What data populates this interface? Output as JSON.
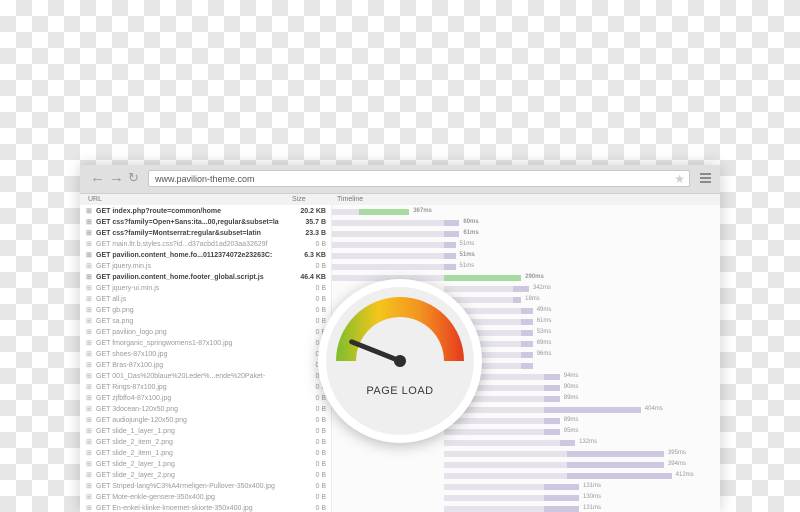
{
  "browser": {
    "back_icon": "arrow-left-icon",
    "forward_icon": "arrow-right-icon",
    "reload_icon": "reload-icon",
    "url": "www.pavilion-theme.com",
    "star_icon": "star-icon",
    "menu_icon": "hamburger-menu-icon"
  },
  "network": {
    "columns": {
      "url": "URL",
      "size": "Size",
      "timeline": "Timeline"
    },
    "rows": [
      {
        "url": "GET index.php?route=common/home",
        "size": "20.2 KB",
        "ms": "367ms",
        "bold": true,
        "wait": 0.0,
        "start": 0.07,
        "dur": 0.13,
        "color": "green"
      },
      {
        "url": "GET css?family=Open+Sans:ita...00,regular&subset=la",
        "size": "35.7 B",
        "ms": "60ms",
        "bold": true,
        "wait": 0.0,
        "start": 0.29,
        "dur": 0.04,
        "color": "purple"
      },
      {
        "url": "GET css?family=Montserrat:regular&subset=latin",
        "size": "23.3 B",
        "ms": "61ms",
        "bold": true,
        "wait": 0.0,
        "start": 0.29,
        "dur": 0.04,
        "color": "purple"
      },
      {
        "url": "GET main.ltr.b.styles.css?id...d37acbd1ad203aa32629f",
        "size": "0 B",
        "ms": "51ms",
        "bold": false,
        "wait": 0.0,
        "start": 0.29,
        "dur": 0.03,
        "color": "purple"
      },
      {
        "url": "GET pavilion.content_home.fo...0112374072e23263C:",
        "size": "6.3 KB",
        "ms": "51ms",
        "bold": true,
        "wait": 0.0,
        "start": 0.29,
        "dur": 0.03,
        "color": "purple"
      },
      {
        "url": "GET jquery.min.js",
        "size": "0 B",
        "ms": "51ms",
        "bold": false,
        "wait": 0.0,
        "start": 0.29,
        "dur": 0.03,
        "color": "purple"
      },
      {
        "url": "GET pavilion.content_home.footer_global.script.js",
        "size": "46.4 KB",
        "ms": "290ms",
        "bold": true,
        "wait": 0.0,
        "start": 0.29,
        "dur": 0.2,
        "color": "green"
      },
      {
        "url": "GET jquery-ui.min.js",
        "size": "0 B",
        "ms": "342ms",
        "bold": false,
        "wait": 0.29,
        "start": 0.47,
        "dur": 0.04,
        "color": "purple"
      },
      {
        "url": "GET all.js",
        "size": "0 B",
        "ms": "18ms",
        "bold": false,
        "wait": 0.29,
        "start": 0.47,
        "dur": 0.02,
        "color": "purple"
      },
      {
        "url": "GET gb.png",
        "size": "0 B",
        "ms": "49ms",
        "bold": false,
        "wait": 0.29,
        "start": 0.49,
        "dur": 0.03,
        "color": "purple"
      },
      {
        "url": "GET sa.png",
        "size": "0 B",
        "ms": "61ms",
        "bold": false,
        "wait": 0.29,
        "start": 0.49,
        "dur": 0.03,
        "color": "purple"
      },
      {
        "url": "GET pavilion_logo.png",
        "size": "0 B",
        "ms": "53ms",
        "bold": false,
        "wait": 0.29,
        "start": 0.49,
        "dur": 0.03,
        "color": "purple"
      },
      {
        "url": "GET fmorganic_springwomens1-87x100.jpg",
        "size": "0 B",
        "ms": "69ms",
        "bold": false,
        "wait": 0.29,
        "start": 0.49,
        "dur": 0.03,
        "color": "purple"
      },
      {
        "url": "GET shoes-87x100.jpg",
        "size": "0 B",
        "ms": "96ms",
        "bold": false,
        "wait": 0.29,
        "start": 0.49,
        "dur": 0.03,
        "color": "purple"
      },
      {
        "url": "GET Bras-87x100.jpg",
        "size": "0 B",
        "ms": "",
        "bold": false,
        "wait": 0.29,
        "start": 0.49,
        "dur": 0.03,
        "color": "purple"
      },
      {
        "url": "GET 001_Das%20blaue%20Leder%...ende%20Paket-",
        "size": "0 B",
        "ms": "94ms",
        "bold": false,
        "wait": 0.29,
        "start": 0.55,
        "dur": 0.04,
        "color": "purple"
      },
      {
        "url": "GET Rings-87x100.jpg",
        "size": "0 B",
        "ms": "90ms",
        "bold": false,
        "wait": 0.29,
        "start": 0.55,
        "dur": 0.04,
        "color": "purple"
      },
      {
        "url": "GET zjfbffo4-87x100.jpg",
        "size": "0 B",
        "ms": "89ms",
        "bold": false,
        "wait": 0.29,
        "start": 0.55,
        "dur": 0.04,
        "color": "purple"
      },
      {
        "url": "GET 3docean-120x50.png",
        "size": "0 B",
        "ms": "404ms",
        "bold": false,
        "wait": 0.29,
        "start": 0.55,
        "dur": 0.25,
        "color": "purple"
      },
      {
        "url": "GET audiojungle-120x50.png",
        "size": "0 B",
        "ms": "89ms",
        "bold": false,
        "wait": 0.29,
        "start": 0.55,
        "dur": 0.04,
        "color": "purple"
      },
      {
        "url": "GET slide_1_layer_1.png",
        "size": "0 B",
        "ms": "95ms",
        "bold": false,
        "wait": 0.29,
        "start": 0.55,
        "dur": 0.04,
        "color": "purple"
      },
      {
        "url": "GET slide_2_item_2.png",
        "size": "0 B",
        "ms": "132ms",
        "bold": false,
        "wait": 0.29,
        "start": 0.59,
        "dur": 0.04,
        "color": "purple"
      },
      {
        "url": "GET slide_2_item_1.png",
        "size": "0 B",
        "ms": "395ms",
        "bold": false,
        "wait": 0.29,
        "start": 0.61,
        "dur": 0.25,
        "color": "purple"
      },
      {
        "url": "GET slide_2_layer_1.png",
        "size": "0 B",
        "ms": "394ms",
        "bold": false,
        "wait": 0.29,
        "start": 0.61,
        "dur": 0.25,
        "color": "purple"
      },
      {
        "url": "GET slide_2_layer_2.png",
        "size": "0 B",
        "ms": "412ms",
        "bold": false,
        "wait": 0.29,
        "start": 0.61,
        "dur": 0.27,
        "color": "purple"
      },
      {
        "url": "GET Striped-lang%C3%A4rmeligen-Pullover-350x400.jpg",
        "size": "0 B",
        "ms": "131ms",
        "bold": false,
        "wait": 0.29,
        "start": 0.55,
        "dur": 0.09,
        "color": "purple"
      },
      {
        "url": "GET Mote-enkle-gensere-350x400.jpg",
        "size": "0 B",
        "ms": "130ms",
        "bold": false,
        "wait": 0.29,
        "start": 0.55,
        "dur": 0.09,
        "color": "purple"
      },
      {
        "url": "GET En-enkel-klinke-lmoemet-skiorte-350x400.jpg",
        "size": "0 B",
        "ms": "131ms",
        "bold": false,
        "wait": 0.29,
        "start": 0.55,
        "dur": 0.09,
        "color": "purple"
      }
    ]
  },
  "gauge": {
    "label": "PAGE LOAD",
    "level": 0.12,
    "colors": {
      "green": "#7dbd2c",
      "yellow": "#f4c51c",
      "orange": "#f39220",
      "red": "#e53a1e",
      "needle": "#2e2e2e"
    }
  }
}
